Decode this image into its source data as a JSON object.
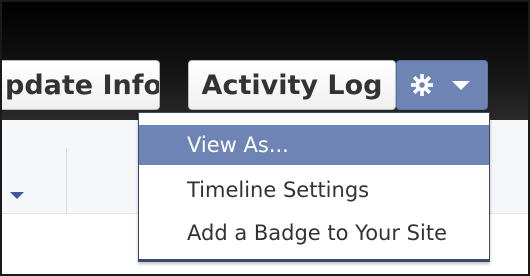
{
  "header": {
    "update_info_label": "pdate Info",
    "activity_log_label": "Activity Log",
    "settings_icon": "gear-icon",
    "dropdown_icon": "caret-down-icon"
  },
  "dropdown_menu": {
    "items": [
      {
        "label": "View As...",
        "selected": true
      },
      {
        "label": "Timeline Settings",
        "selected": false
      },
      {
        "label": "Add a Badge to Your Site",
        "selected": false
      }
    ]
  },
  "colors": {
    "accent": "#6d84b4",
    "header_bg": "#000000",
    "menu_border": "#3b4a6b"
  }
}
